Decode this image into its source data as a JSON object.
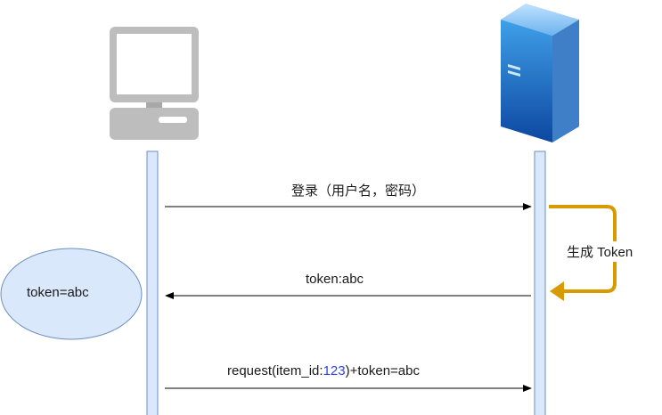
{
  "messages": {
    "login": "登录（用户名，密码）",
    "token_reply": "token:abc",
    "request_prefix": "request(item_id:",
    "request_id": "123",
    "request_suffix": ")+token=abc"
  },
  "server_note": "生成 Token",
  "client_state": "token=abc",
  "colors": {
    "lifeline_fill": "#dae8fc",
    "lifeline_stroke": "#6c8ebf",
    "self_arrow": "#d79b00",
    "ellipse_fill": "#dae8fc",
    "number_highlight": "#2f3fe8"
  },
  "icons": {
    "client": "desktop-computer-icon",
    "server": "server-tower-icon"
  }
}
